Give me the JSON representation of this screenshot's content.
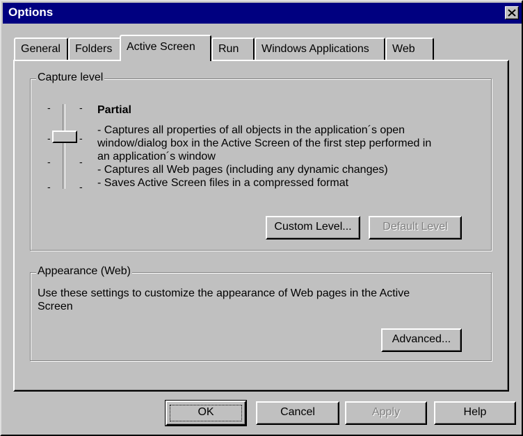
{
  "window": {
    "title": "Options"
  },
  "tabs": [
    {
      "label": "General"
    },
    {
      "label": "Folders"
    },
    {
      "label": "Active Screen",
      "active": true
    },
    {
      "label": "Run"
    },
    {
      "label": "Windows Applications"
    },
    {
      "label": "Web"
    }
  ],
  "capture_level": {
    "group_label": "Capture level",
    "level_name": "Partial",
    "description": [
      "- Captures all properties of all objects in the application´s open",
      "window/dialog box in the Active Screen of the first step performed in",
      "an application´s window",
      "- Captures all Web pages (including any dynamic changes)",
      "- Saves Active Screen files in a compressed format"
    ],
    "custom_level_button": "Custom Level...",
    "default_level_button": "Default Level"
  },
  "appearance": {
    "group_label": "Appearance (Web)",
    "description": [
      "Use these settings to customize the appearance of Web pages in the Active",
      "Screen"
    ],
    "advanced_button": "Advanced..."
  },
  "footer": {
    "ok": "OK",
    "cancel": "Cancel",
    "apply": "Apply",
    "help": "Help"
  }
}
